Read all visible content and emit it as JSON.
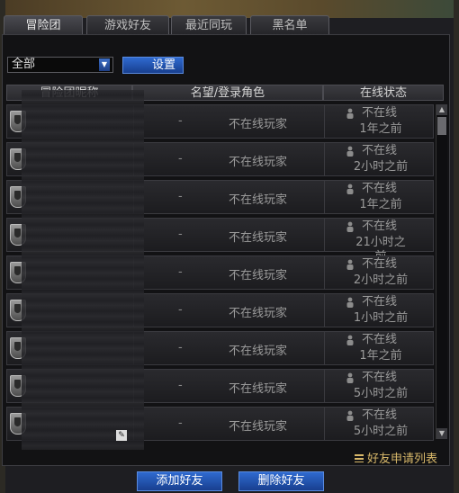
{
  "tabs": [
    {
      "label": "冒险团"
    },
    {
      "label": "游戏好友"
    },
    {
      "label": "最近同玩"
    },
    {
      "label": "黑名单"
    }
  ],
  "filter": {
    "selected": "全部"
  },
  "settings_button": "设置",
  "columns": {
    "col1": "冒险团昵称",
    "col2": "名望/登录角色",
    "col3": "在线状态"
  },
  "rows": [
    {
      "role_dash": "-",
      "role": "不在线玩家",
      "status": "不在线",
      "ago": "1年之前"
    },
    {
      "role_dash": "-",
      "role": "不在线玩家",
      "status": "不在线",
      "ago": "2小时之前"
    },
    {
      "role_dash": "-",
      "role": "不在线玩家",
      "status": "不在线",
      "ago": "1年之前"
    },
    {
      "role_dash": "-",
      "role": "不在线玩家",
      "status": "不在线",
      "ago": "21小时之前"
    },
    {
      "role_dash": "-",
      "role": "不在线玩家",
      "status": "不在线",
      "ago": "2小时之前"
    },
    {
      "role_dash": "-",
      "role": "不在线玩家",
      "status": "不在线",
      "ago": "1小时之前"
    },
    {
      "role_dash": "-",
      "role": "不在线玩家",
      "status": "不在线",
      "ago": "1年之前"
    },
    {
      "role_dash": "-",
      "role": "不在线玩家",
      "status": "不在线",
      "ago": "5小时之前"
    },
    {
      "role_dash": "-",
      "role": "不在线玩家",
      "status": "不在线",
      "ago": "5小时之前"
    }
  ],
  "friend_requests_link": "好友申请列表",
  "add_friend_button": "添加好友",
  "delete_friend_button": "删除好友"
}
